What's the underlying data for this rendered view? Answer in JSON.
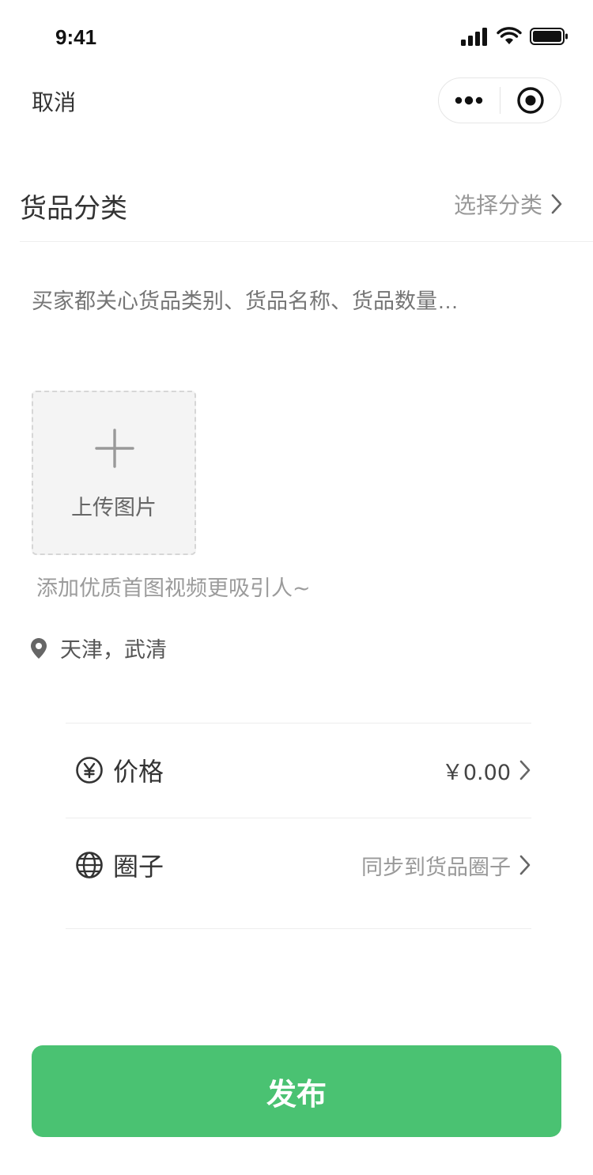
{
  "status_bar": {
    "time": "9:41"
  },
  "nav": {
    "cancel_label": "取消"
  },
  "category": {
    "title": "货品分类",
    "select_label": "选择分类"
  },
  "description": {
    "placeholder": "买家都关心货品类别、货品名称、货品数量…"
  },
  "upload": {
    "label": "上传图片",
    "hint": "添加优质首图视频更吸引人~"
  },
  "location": {
    "text": "天津，武清"
  },
  "price": {
    "label": "价格",
    "value": "￥0.00"
  },
  "circle": {
    "label": "圈子",
    "value": "同步到货品圈子"
  },
  "publish": {
    "label": "发布"
  },
  "colors": {
    "primary": "#4ac272",
    "muted_text": "#999999",
    "text": "#333333",
    "divider": "#ededed"
  }
}
